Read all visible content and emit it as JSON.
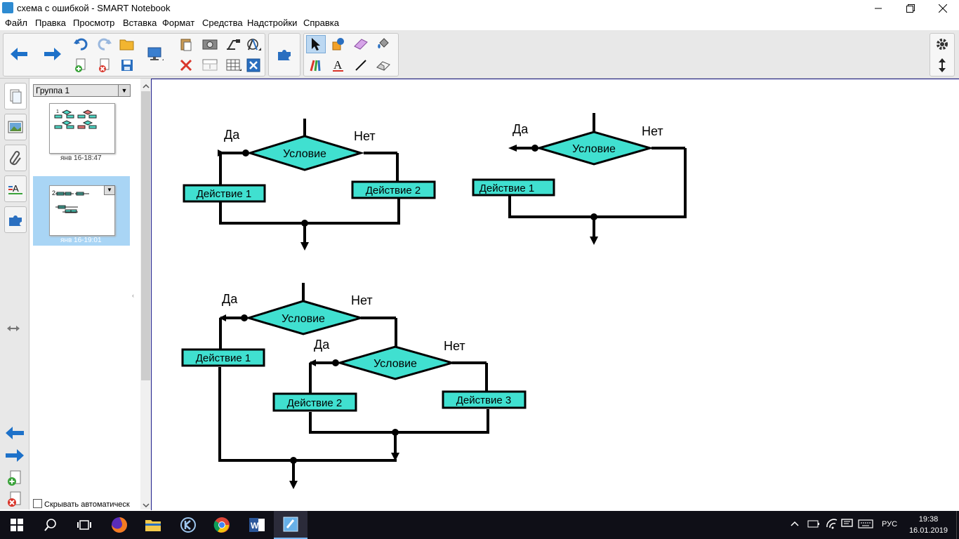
{
  "window": {
    "title": "схема с ошибкой - SMART Notebook"
  },
  "menu": [
    "Файл",
    "Правка",
    "Просмотр",
    "Вставка",
    "Формат",
    "Средства",
    "Надстройки",
    "Справка"
  ],
  "sidebar": {
    "group_select": "Группа 1",
    "pages": [
      {
        "label": "янв 16-18:47",
        "selected": false
      },
      {
        "label": "янв 16-19:01",
        "selected": true
      }
    ],
    "autohide_label": "Скрывать автоматическ"
  },
  "canvas": {
    "flow1": {
      "yes": "Да",
      "no": "Нет",
      "condition": "Условие",
      "action1": "Действие 1",
      "action2": "Действие 2"
    },
    "flow2": {
      "yes": "Да",
      "no": "Нет",
      "condition": "Условие",
      "action1": "Действие 1"
    },
    "flow3": {
      "yes": "Да",
      "no": "Нет",
      "condition": "Условие",
      "action1": "Действие 1",
      "yes2": "Да",
      "no2": "Нет",
      "condition2": "Условие",
      "action2": "Действие 2",
      "action3": "Действие 3"
    }
  },
  "colors": {
    "shape_fill": "#40e0d0",
    "selected_page": "#a9d5f5"
  },
  "taskbar": {
    "language": "РУС",
    "time": "19:38",
    "date": "16.01.2019"
  }
}
